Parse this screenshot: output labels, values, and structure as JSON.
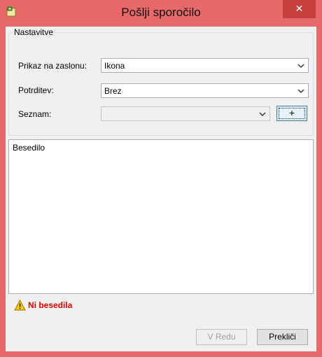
{
  "window": {
    "title": "Pošlji sporočilo",
    "close_glyph": "✕",
    "icon": "message-icon"
  },
  "settings": {
    "group_title": "Nastavitve",
    "display_label": "Prikaz na zaslonu:",
    "display_value": "Ikona",
    "confirm_label": "Potrditev:",
    "confirm_value": "Brez",
    "list_label": "Seznam:",
    "list_value": "",
    "add_button": "+"
  },
  "text_group": {
    "title": "Besedilo",
    "value": ""
  },
  "warning": {
    "text": "Ni besedila",
    "icon": "warning-icon",
    "color": "#e00000"
  },
  "buttons": {
    "ok": "V Redu",
    "cancel": "Prekliči"
  },
  "colors": {
    "frame": "#e8696a",
    "close": "#c7403d"
  }
}
